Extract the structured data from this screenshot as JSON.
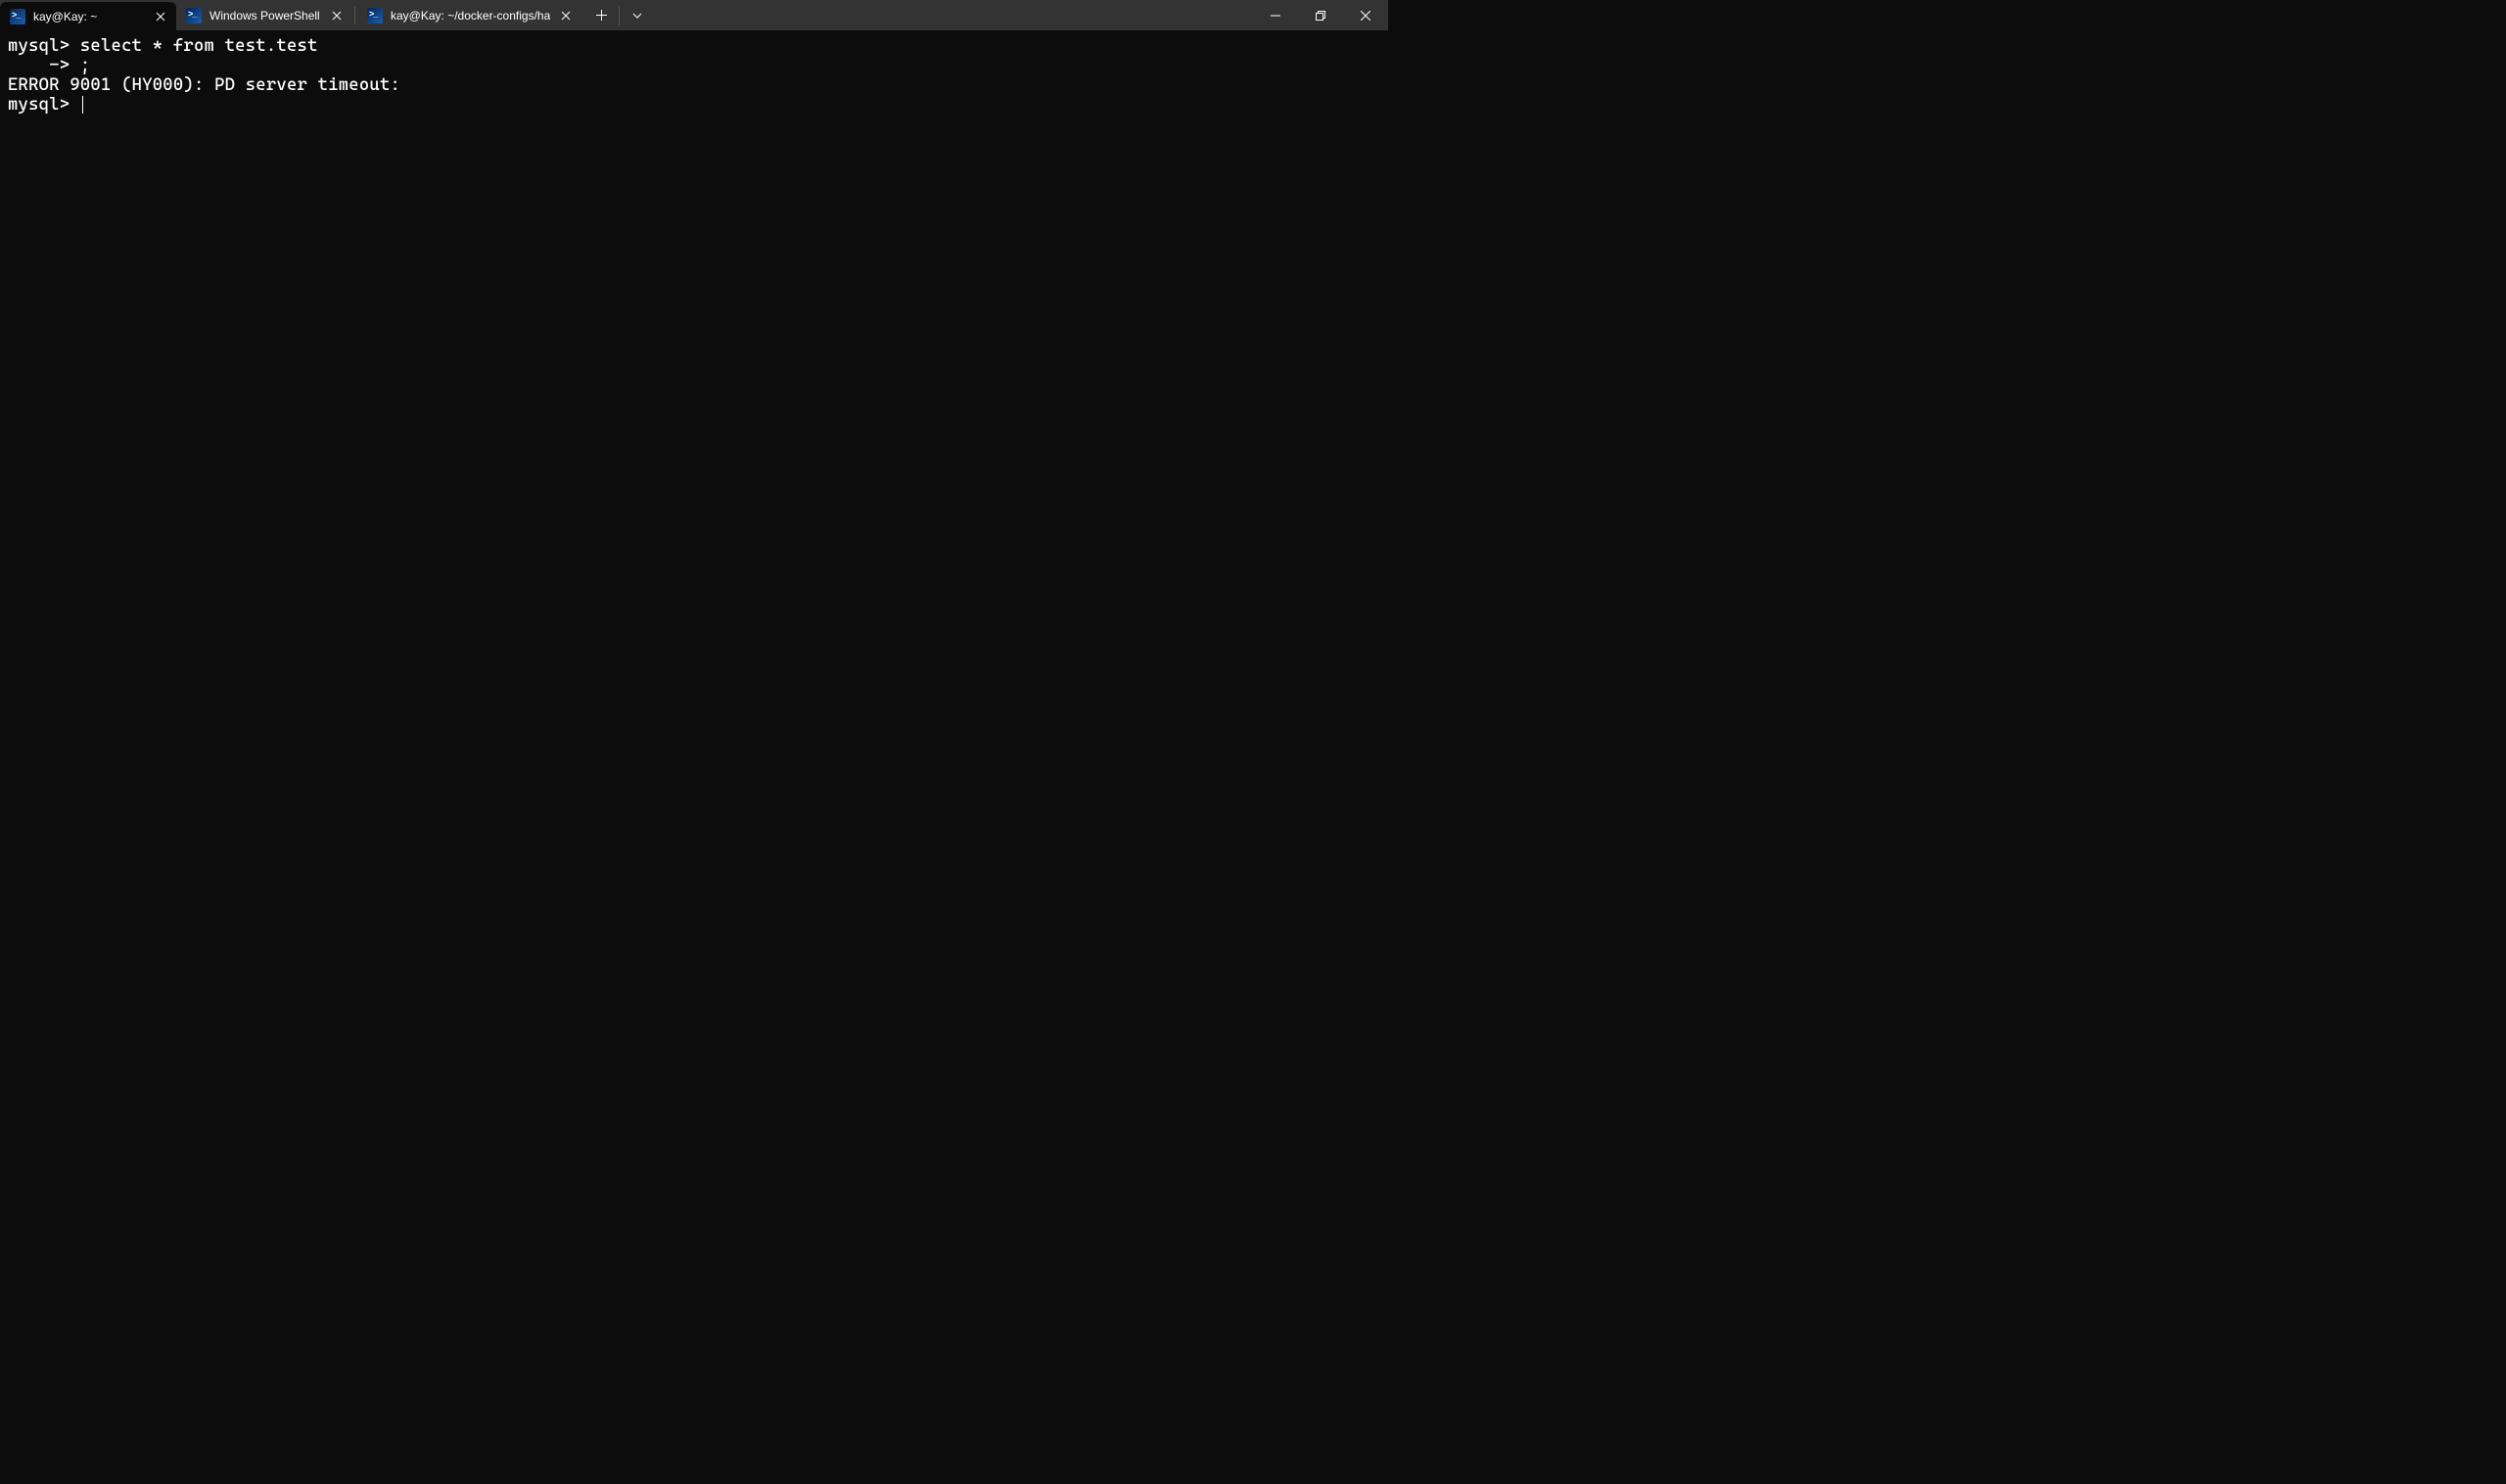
{
  "tabs": [
    {
      "title": "kay@Kay: ~",
      "active": true
    },
    {
      "title": "Windows PowerShell",
      "active": false
    },
    {
      "title": "kay@Kay: ~/docker-configs/ha",
      "active": false
    }
  ],
  "terminal": {
    "line1": "mysql> select * from test.test",
    "line2": "    -> ;",
    "line3": "ERROR 9001 (HY000): PD server timeout:",
    "line4": "mysql> "
  }
}
